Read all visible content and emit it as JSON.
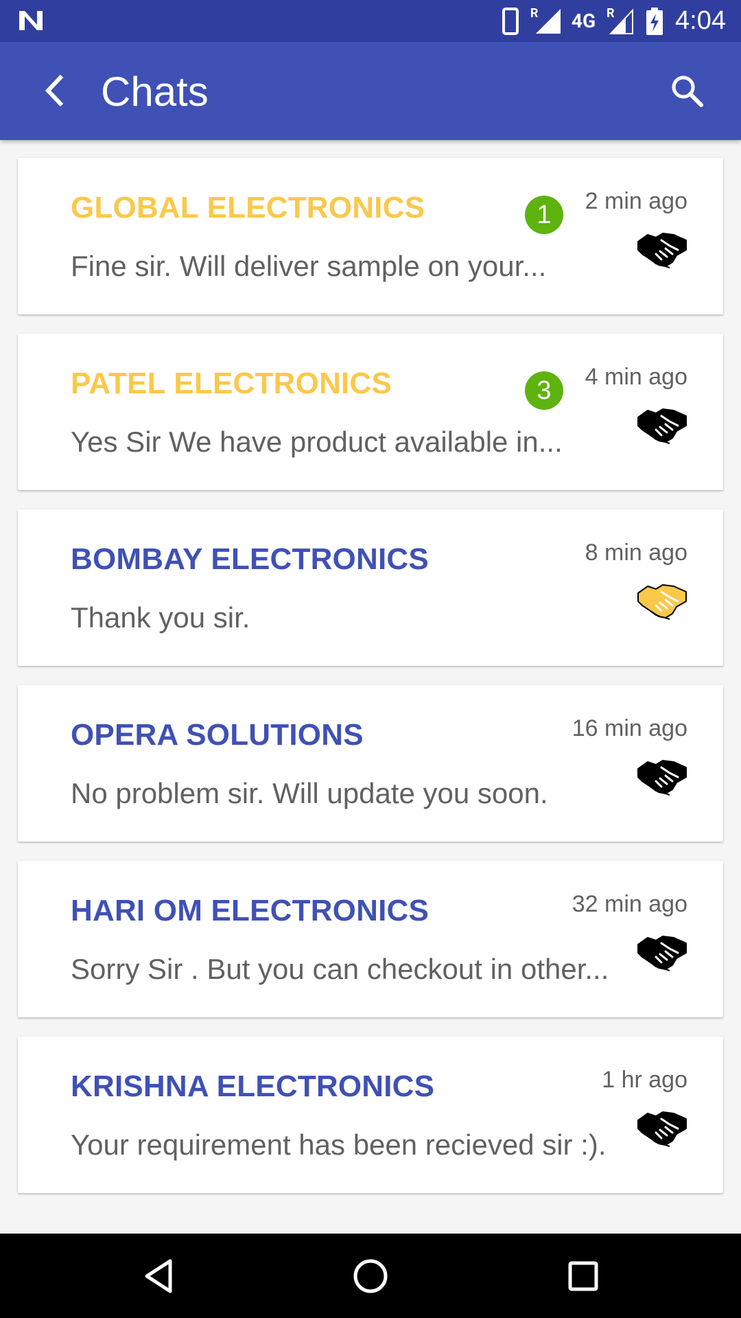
{
  "status_bar": {
    "time": "4:04",
    "network": "4G",
    "roaming_1": "R",
    "roaming_2": "R",
    "icons": [
      "notification-n-icon",
      "phone-icon",
      "signal-icon",
      "signal-icon",
      "battery-charging-icon"
    ]
  },
  "app_bar": {
    "title": "Chats",
    "back_icon": "back-arrow-icon",
    "search_icon": "search-icon"
  },
  "colors": {
    "primary": "#3f51b5",
    "primary_dark": "#303f9f",
    "unread_name": "#fbc84a",
    "badge": "#5eb30e",
    "deal_active": "#fbc84a"
  },
  "chats": [
    {
      "name": "GLOBAL ELECTRONICS",
      "message": "Fine sir. Will deliver sample on your...",
      "time": "2 min ago",
      "unread": "1",
      "deal_icon": "handshake-icon"
    },
    {
      "name": "PATEL ELECTRONICS",
      "message": "Yes Sir We have product available in...",
      "time": "4 min ago",
      "unread": "3",
      "deal_icon": "handshake-icon"
    },
    {
      "name": "BOMBAY ELECTRONICS",
      "message": "Thank you sir.",
      "time": "8 min ago",
      "unread": "",
      "deal_icon": "handshake-icon"
    },
    {
      "name": "OPERA SOLUTIONS",
      "message": "No problem sir. Will update you soon.",
      "time": "16 min ago",
      "unread": "",
      "deal_icon": "handshake-icon"
    },
    {
      "name": "HARI OM ELECTRONICS",
      "message": "Sorry Sir . But you can checkout in other...",
      "time": "32 min ago",
      "unread": "",
      "deal_icon": "handshake-icon"
    },
    {
      "name": "KRISHNA ELECTRONICS",
      "message": "Your requirement has been recieved sir :).",
      "time": "1 hr ago",
      "unread": "",
      "deal_icon": "handshake-icon"
    }
  ],
  "nav_bar": {
    "icons": [
      "back-triangle-icon",
      "home-circle-icon",
      "recents-square-icon"
    ]
  }
}
